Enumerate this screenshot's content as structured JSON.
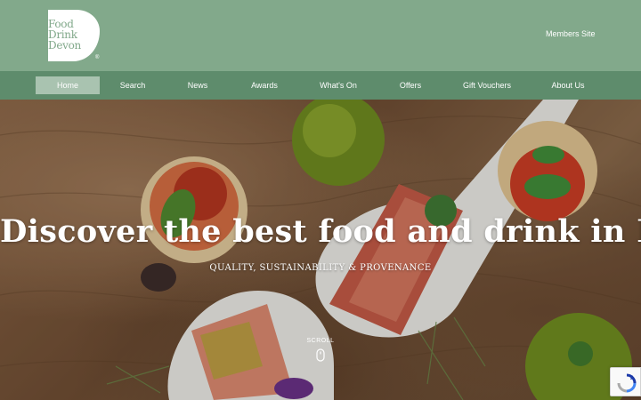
{
  "header": {
    "logo": {
      "line1": "Food",
      "line2": "Drink",
      "line3": "Devon",
      "reg": "®"
    },
    "members_link": "Members Site"
  },
  "nav": {
    "items": [
      {
        "label": "Home",
        "active": true
      },
      {
        "label": "Search"
      },
      {
        "label": "News"
      },
      {
        "label": "Awards"
      },
      {
        "label": "What's On"
      },
      {
        "label": "Offers"
      },
      {
        "label": "Gift Vouchers"
      },
      {
        "label": "About Us"
      }
    ]
  },
  "hero": {
    "title": "Discover the best food and drink in Devon",
    "subtitle": "QUALITY, SUSTAINABILITY & PROVENANCE",
    "scroll_label": "SCROLL"
  },
  "colors": {
    "header_bg": "#82a98b",
    "nav_bg": "#5e8c6c",
    "nav_active_bg": "#a9c3b0",
    "text": "#ffffff"
  }
}
